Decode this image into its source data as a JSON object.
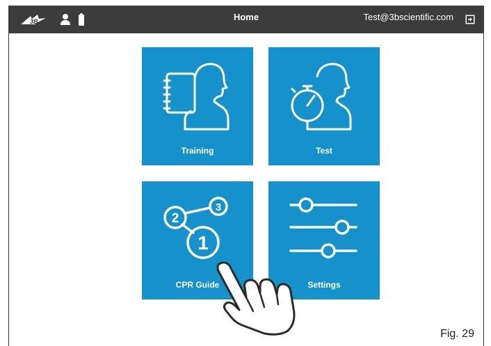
{
  "header": {
    "title": "Home",
    "user_email": "Test@3bscientific.com",
    "logo_text": "3B",
    "icons": [
      "3b-logo",
      "user-icon",
      "battery-icon",
      "logout-icon"
    ]
  },
  "tiles": [
    {
      "label": "Training",
      "icon": "training-icon"
    },
    {
      "label": "Test",
      "icon": "stopwatch-head-icon"
    },
    {
      "label": "CPR Guide",
      "icon": "cpr-guide-icon",
      "steps": [
        "1",
        "2",
        "3"
      ]
    },
    {
      "label": "Settings",
      "icon": "sliders-icon"
    }
  ],
  "figure_caption": "Fig. 29",
  "colors": {
    "topbar": "#3c3c3c",
    "tile": "#1592cb",
    "icon": "#ffffff"
  }
}
